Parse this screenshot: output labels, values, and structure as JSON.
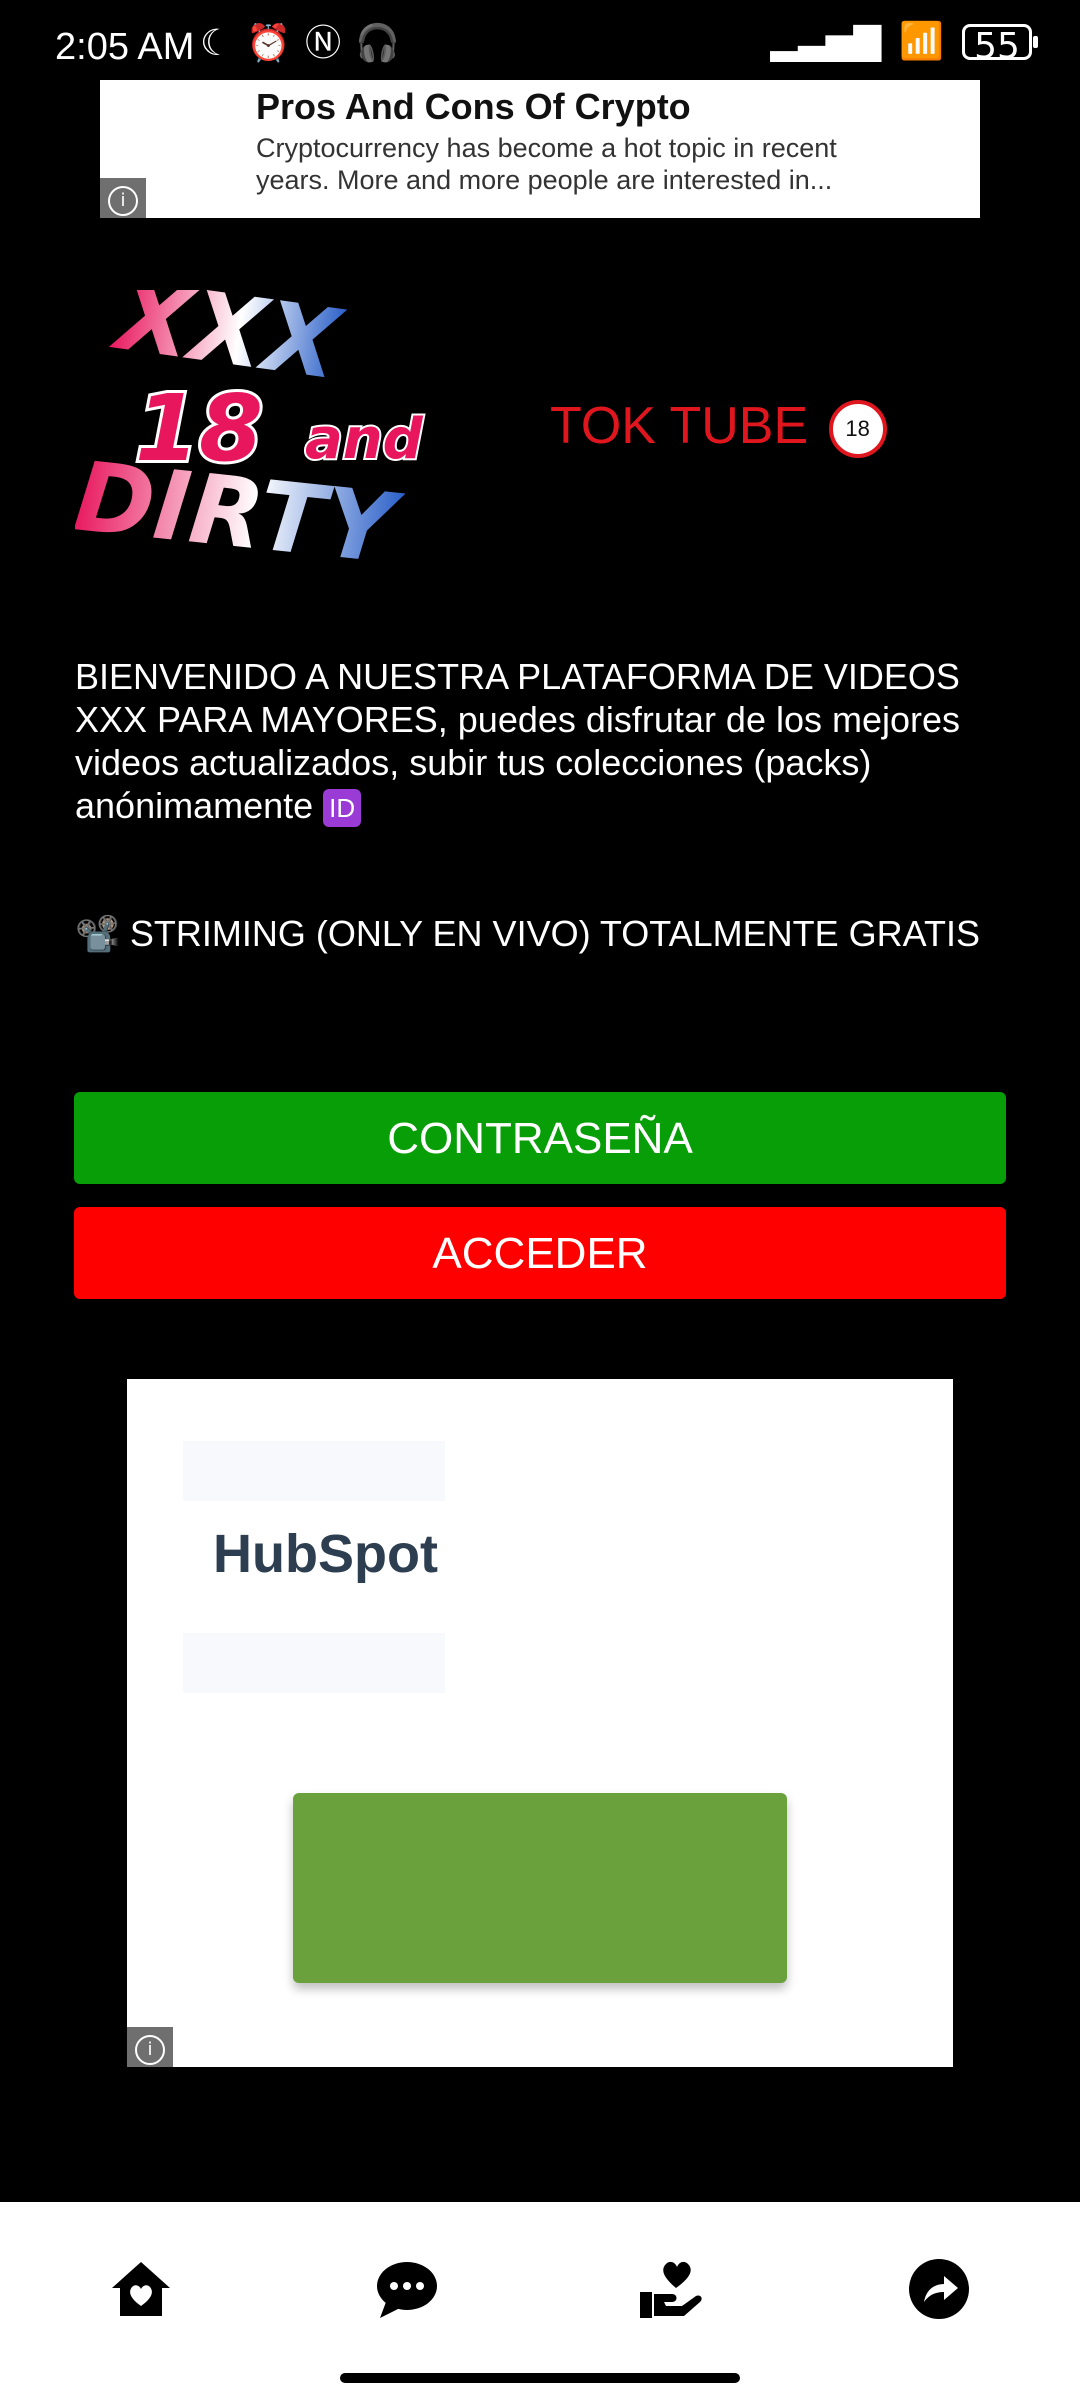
{
  "status_bar": {
    "time": "2:05 AM",
    "battery": "55",
    "left_icons": [
      "moon-icon",
      "alarm-icon",
      "nfc-icon",
      "headphones-icon"
    ],
    "right_icons": [
      "signal-icon",
      "wifi-icon",
      "battery-icon"
    ]
  },
  "top_ad": {
    "title": "Pros And Cons Of Crypto",
    "description": "Cryptocurrency has become a hot topic in recent years. More and more people are interested in...",
    "info_icon": "info-icon"
  },
  "logo": {
    "text_xxx": "XXX",
    "text_18": "18",
    "text_and": "and",
    "text_dirty": "DIRTY"
  },
  "app_title": "TOK TUBE",
  "under18_badge": "18",
  "welcome_text": "BIENVENIDO A NUESTRA PLATAFORMA DE VIDEOS XXX PARA MAYORES, puedes disfrutar de los mejores videos actualizados, subir tus colecciones (packs) anónimamente",
  "welcome_badge": "ID",
  "streaming_text": "STRIMING (ONLY EN VIVO) TOTALMENTE GRATIS",
  "buttons": {
    "password": "CONTRASEÑA",
    "access": "ACCEDER"
  },
  "bottom_ad": {
    "brand": "HubSpot"
  },
  "bottom_nav": {
    "items": [
      "home-icon",
      "chat-icon",
      "donate-icon",
      "share-icon"
    ]
  }
}
